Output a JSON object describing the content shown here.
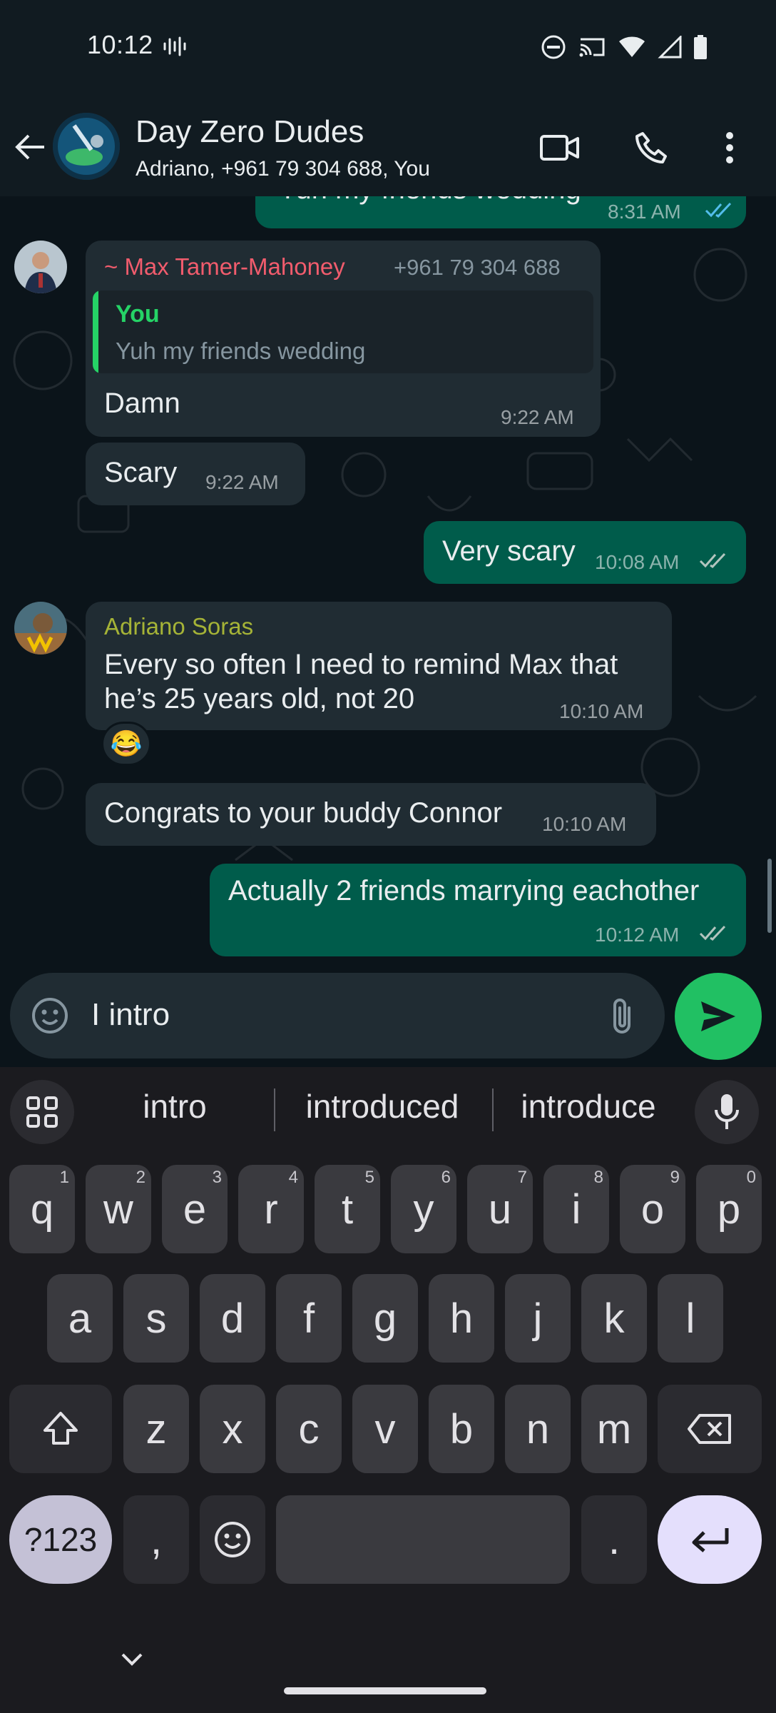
{
  "status_bar": {
    "time": "10:12"
  },
  "header": {
    "title": "Day Zero Dudes",
    "subtitle": "Adriano, +961 79 304 688, You"
  },
  "messages": {
    "top_partial": {
      "text": "Yuh my friends wedding",
      "time": "8:31 AM"
    },
    "max_reply": {
      "sender": "~ Max Tamer-Mahoney",
      "phone": "+961 79 304 688",
      "quote_author": "You",
      "quote_text": "Yuh my friends wedding",
      "text": "Damn",
      "time": "9:22 AM"
    },
    "max_scary": {
      "text": "Scary",
      "time": "9:22 AM"
    },
    "me_very_scary": {
      "text": "Very scary",
      "time": "10:08 AM"
    },
    "adriano_remind": {
      "sender": "Adriano Soras",
      "line1": "Every so often I need to remind Max that",
      "line2": "he’s 25 years old, not 20",
      "time": "10:10 AM",
      "reaction": "😂"
    },
    "adriano_congrats": {
      "text": "Congrats to your buddy Connor",
      "time": "10:10 AM"
    },
    "me_actually": {
      "text": "Actually 2 friends marrying eachother",
      "time": "10:12 AM"
    }
  },
  "composer": {
    "value": "I intro"
  },
  "keyboard": {
    "suggestions": [
      "intro",
      "introduced",
      "introduce"
    ],
    "row1": [
      {
        "k": "q",
        "h": "1"
      },
      {
        "k": "w",
        "h": "2"
      },
      {
        "k": "e",
        "h": "3"
      },
      {
        "k": "r",
        "h": "4"
      },
      {
        "k": "t",
        "h": "5"
      },
      {
        "k": "y",
        "h": "6"
      },
      {
        "k": "u",
        "h": "7"
      },
      {
        "k": "i",
        "h": "8"
      },
      {
        "k": "o",
        "h": "9"
      },
      {
        "k": "p",
        "h": "0"
      }
    ],
    "row2": [
      "a",
      "s",
      "d",
      "f",
      "g",
      "h",
      "j",
      "k",
      "l"
    ],
    "row3": [
      "z",
      "x",
      "c",
      "v",
      "b",
      "n",
      "m"
    ],
    "sym_label": "?123",
    "comma": ",",
    "period": "."
  },
  "colors": {
    "outgoing_bubble": "#005c4b",
    "incoming_bubble": "#202c33",
    "max_name": "#f15c6d",
    "adriano_name": "#a5b337",
    "quote_you": "#25d366",
    "send_button": "#21c063",
    "read_ticks": "#53bdeb"
  }
}
